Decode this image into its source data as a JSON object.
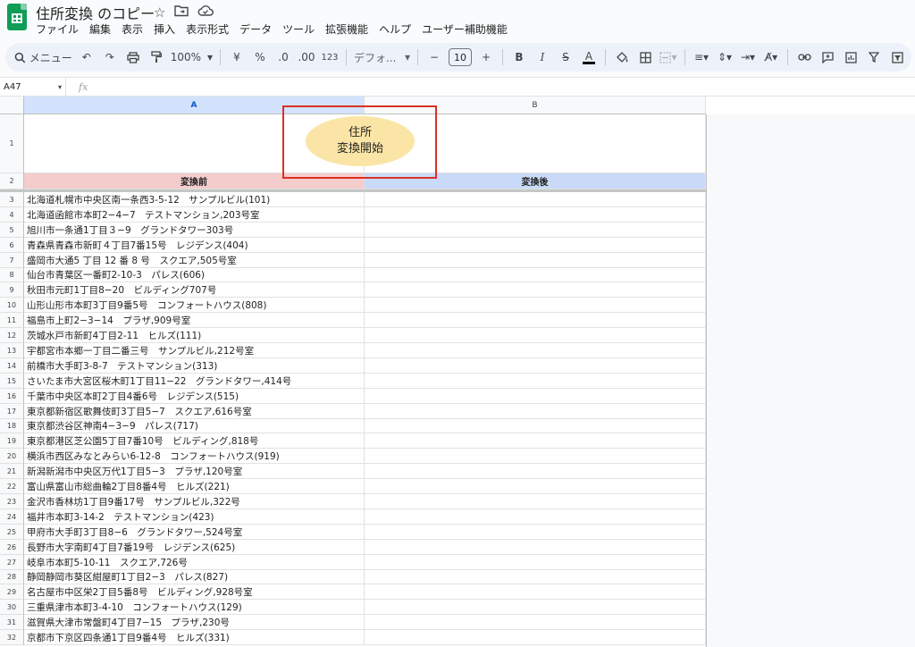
{
  "doc": {
    "title": "住所変換 のコピー"
  },
  "menu": [
    "ファイル",
    "編集",
    "表示",
    "挿入",
    "表示形式",
    "データ",
    "ツール",
    "拡張機能",
    "ヘルプ",
    "ユーザー補助機能"
  ],
  "toolbar": {
    "search": "メニュー",
    "zoom": "100%",
    "currency": "¥",
    "percent": "%",
    "dec_decrease": ".0",
    "dec_increase": ".00",
    "number_format": "123",
    "font": "デフォ...",
    "font_size": "10",
    "minus": "−",
    "plus": "+",
    "bold": "B",
    "italic": "I",
    "strike": "S",
    "text_color": "A"
  },
  "formula_bar": {
    "cell_ref": "A47",
    "fx": "fx"
  },
  "columns": [
    "A",
    "B"
  ],
  "button": {
    "line1": "住所",
    "line2": "変換開始"
  },
  "headers": {
    "a": "変換前",
    "b": "変換後"
  },
  "rows": [
    "北海道札幌市中央区南一条西3-5-12　サンプルビル(101)",
    "北海道函館市本町2−4−7　テストマンション,203号室",
    "旭川市一条通1丁目３−9　グランドタワー303号",
    "青森県青森市新町４丁目7番15号　レジデンス(404)",
    "盛岡市大通5 丁目 12 番 8 号　スクエア,505号室",
    "仙台市青葉区一番町2-10-3　パレス(606)",
    "秋田市元町1丁目8−20　ビルディング707号",
    "山形山形市本町3丁目9番5号　コンフォートハウス(808)",
    "福島市上町2−3−14　プラザ,909号室",
    "茨城水戸市新町4丁目2-11　ヒルズ(111)",
    "宇都宮市本郷一丁目二番三号　サンプルビル,212号室",
    "前橋市大手町3-8-7　テストマンション(313)",
    "さいたま市大宮区桜木町1丁目11−22　グランドタワー,414号",
    "千葉市中央区本町2丁目4番6号　レジデンス(515)",
    "東京都新宿区歌舞伎町3丁目5−7　スクエア,616号室",
    "東京都渋谷区神南4−3−9　パレス(717)",
    "東京都港区芝公園5丁目7番10号　ビルディング,818号",
    "横浜市西区みなとみらい6-12-8　コンフォートハウス(919)",
    "新潟新潟市中央区万代1丁目5−3　プラザ,120号室",
    "富山県富山市総曲輪2丁目8番4号　ヒルズ(221)",
    "金沢市香林坊1丁目9番17号　サンプルビル,322号",
    "福井市本町3-14-2　テストマンション(423)",
    "甲府市大手町3丁目8−6　グランドタワー,524号室",
    "長野市大字南町4丁目7番19号　レジデンス(625)",
    "岐阜市本町5-10-11　スクエア,726号",
    "静岡静岡市葵区紺屋町1丁目2−3　パレス(827)",
    "名古屋市中区栄2丁目5番8号　ビルディング,928号室",
    "三重県津市本町3-4-10　コンフォートハウス(129)",
    "滋賀県大津市常盤町4丁目7−15　プラザ,230号",
    "京都市下京区四条通1丁目9番4号　ヒルズ(331)"
  ],
  "colors": {
    "header_a": "#f4cccc",
    "header_b": "#c9daf8",
    "button": "#fbe5a6",
    "highlight": "#d93025",
    "brand": "#0f9d58"
  }
}
